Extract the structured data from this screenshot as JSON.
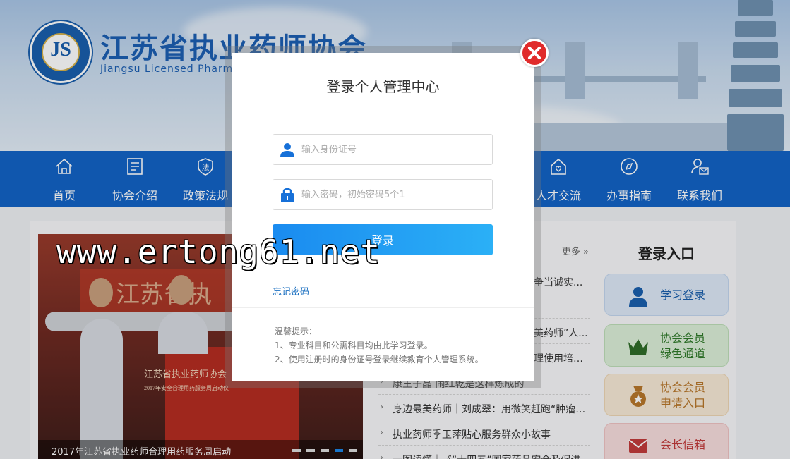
{
  "header": {
    "title": "江苏省执业药师协会",
    "subtitle": "Jiangsu Licensed Pharmaci",
    "logo_letters": "JS"
  },
  "nav": {
    "items": [
      {
        "label": "首页",
        "icon": "home-icon"
      },
      {
        "label": "协会介绍",
        "icon": "document-icon"
      },
      {
        "label": "政策法规",
        "icon": "law-shield-icon"
      },
      {
        "label": "人才交流",
        "icon": "talent-home-icon"
      },
      {
        "label": "办事指南",
        "icon": "compass-icon"
      },
      {
        "label": "联系我们",
        "icon": "contact-icon"
      }
    ]
  },
  "slider": {
    "caption": "2017年江苏省执业药师合理用药服务周启动",
    "banner_text": "江苏省执",
    "board_text": "江苏省执业药师协会",
    "board_sub": "2017年安全合理用药服务周启动仪",
    "dots": 5,
    "active_dot": 4
  },
  "news": {
    "more": "更多",
    "items": [
      "争当诚实...",
      "美药师”人...",
      "理使用培训...",
      "康王子晶 闹红乾是这样炼成的",
      "身边最美药师｜刘成翠：用微笑赶跑“肿瘤君”",
      "执业药师季玉萍贴心服务群众小故事",
      "一图读懂｜《“十四五”国家药品安全及促进"
    ]
  },
  "login_side": {
    "title": "登录入口",
    "buttons": [
      {
        "label": "学习登录",
        "icon": "user-icon",
        "color": "#dde9f7",
        "text_color": "#1a5fae"
      },
      {
        "label": "协会会员\n绿色通道",
        "line1": "协会会员",
        "line2": "绿色通道",
        "icon": "crown-icon",
        "color": "#dcefd9",
        "text_color": "#2f7a2a"
      },
      {
        "label": "协会会员\n申请入口",
        "line1": "协会会员",
        "line2": "申请入口",
        "icon": "medal-icon",
        "color": "#f8ead6",
        "text_color": "#b8772b"
      },
      {
        "label": "会长信箱",
        "icon": "mail-icon",
        "color": "#f7dddd",
        "text_color": "#c23b3b"
      }
    ]
  },
  "modal": {
    "title": "登录个人管理中心",
    "id_placeholder": "输入身份证号",
    "password_placeholder": "输入密码，初始密码5个1",
    "login_label": "登录",
    "forgot_label": "忘记密码",
    "tips_title": "温馨提示：",
    "tip1": "1、专业科目和公需科目均由此学习登录。",
    "tip2": "2、使用注册时的身份证号登录继续教育个人管理系统。"
  },
  "watermark": "www.ertong61.net",
  "colors": {
    "nav_bg": "#1363c6",
    "login_button": "#1a8bf0",
    "close_button": "#e02b2b",
    "title_blue": "#1c5fb3"
  }
}
